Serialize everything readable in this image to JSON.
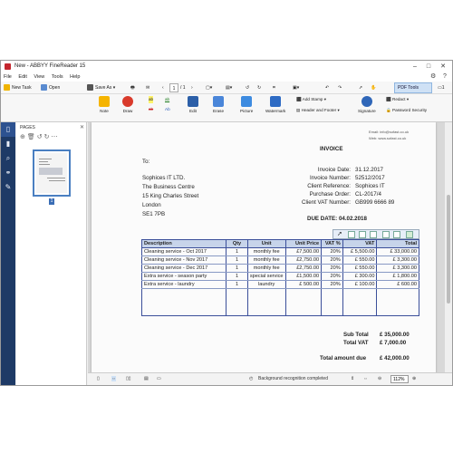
{
  "window": {
    "title": "New - ABBYY FineReader 15"
  },
  "menu": [
    "File",
    "Edit",
    "View",
    "Tools",
    "Help"
  ],
  "toolbar": {
    "new_task": "New Task",
    "open": "Open",
    "save_as": "Save As",
    "page_current": "1",
    "page_total": "/ 1",
    "pdf_tools": "PDF Tools",
    "comments_count": "1"
  },
  "ribbon": {
    "note": "Note",
    "draw": "Draw",
    "edit": "Edit",
    "erase": "Erase",
    "picture": "Picture",
    "watermark": "Watermark",
    "add_stamp": "Add Stamp",
    "header_footer": "Header and Footer",
    "signature": "Signature",
    "redact": "Redact",
    "password_security": "Password Security"
  },
  "pages_panel": {
    "title": "PAGES",
    "page_number": "1"
  },
  "invoice": {
    "email": "Email: info@sofast.co.uk",
    "web": "Web: www.sofast.co.uk",
    "title": "INVOICE",
    "to": "To:",
    "address": [
      "Sophices IT LTD.",
      "The Business Centre",
      "15 King Charles Street",
      "London",
      "SE1 7PB"
    ],
    "meta_labels": [
      "Invoice Date:",
      "Invoice Number:",
      "Client Reference:",
      "Purchase Order:",
      "Client VAT Number:"
    ],
    "meta_values": [
      "31.12.2017",
      "52512/2017",
      "Sophices IT",
      "CL-2017/4",
      "GB999 6666 89"
    ],
    "due_date": "DUE DATE: 04.02.2018",
    "columns": [
      "Description",
      "Qty",
      "Unit",
      "Unit Price",
      "VAT %",
      "VAT",
      "Total"
    ],
    "rows": [
      [
        "Cleaning service - Oct 2017",
        "1",
        "monthly fee",
        "£7,500.00",
        "20%",
        "£   5,500.00",
        "£     33,000.00"
      ],
      [
        "Cleaning service - Nov 2017",
        "1",
        "monthly fee",
        "£2,750.00",
        "20%",
        "£     550.00",
        "£       3,300.00"
      ],
      [
        "Cleaning service - Dec 2017",
        "1",
        "monthly fee",
        "£2,750.00",
        "20%",
        "£     550.00",
        "£       3,300.00"
      ],
      [
        "Extra service - season party",
        "1",
        "special service",
        "£1,500.00",
        "20%",
        "£     300.00",
        "£       1,800.00"
      ],
      [
        "Extra service - laundry",
        "1",
        "laundry",
        "£     500.00",
        "20%",
        "£     100.00",
        "£          600.00"
      ]
    ],
    "sub_total_label": "Sub Total",
    "sub_total": "£    35,000.00",
    "total_vat_label": "Total VAT",
    "total_vat": "£      7,000.00",
    "amount_due_label": "Total amount due",
    "amount_due": "£    42,000.00"
  },
  "status": {
    "background_recognition": "Background recognition completed",
    "zoom": "112%"
  }
}
